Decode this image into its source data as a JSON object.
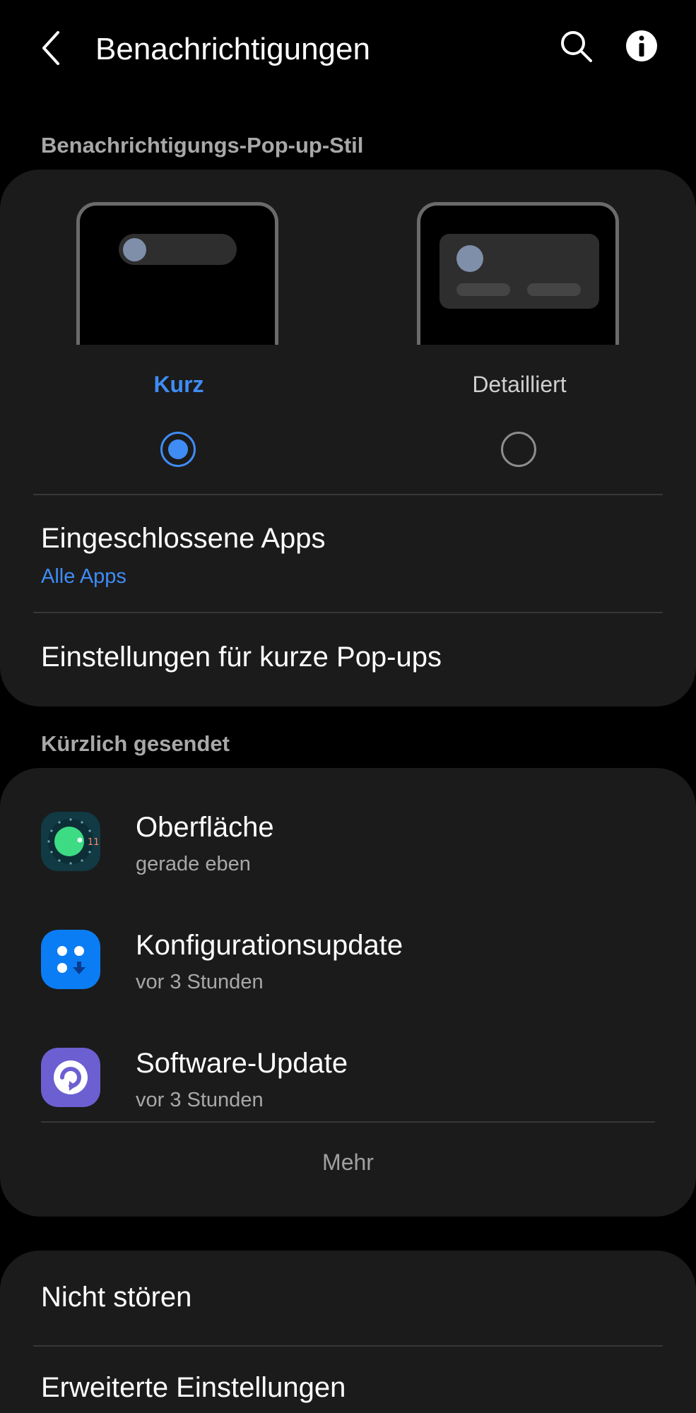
{
  "header": {
    "title": "Benachrichtigungen",
    "back_icon": "back-arrow-icon",
    "search_icon": "search-icon",
    "info_icon": "info-icon"
  },
  "popup_style": {
    "section_label": "Benachrichtigungs-Pop-up-Stil",
    "options": [
      {
        "label": "Kurz",
        "selected": true
      },
      {
        "label": "Detailliert",
        "selected": false
      }
    ],
    "included_apps": {
      "title": "Eingeschlossene Apps",
      "value": "Alle Apps"
    },
    "brief_settings": {
      "title": "Einstellungen für kurze Pop-ups"
    }
  },
  "recent": {
    "section_label": "Kürzlich gesendet",
    "items": [
      {
        "name": "Oberfläche",
        "time": "gerade eben",
        "icon": "android-11-icon"
      },
      {
        "name": "Konfigurationsupdate",
        "time": "vor 3 Stunden",
        "icon": "config-update-icon"
      },
      {
        "name": "Software-Update",
        "time": "vor 3 Stunden",
        "icon": "software-update-icon"
      }
    ],
    "more_label": "Mehr"
  },
  "more_settings": {
    "items": [
      {
        "title": "Nicht stören"
      },
      {
        "title": "Erweiterte Einstellungen"
      }
    ]
  },
  "colors": {
    "accent": "#3f8cf5",
    "background": "#000000",
    "card": "#1b1b1b"
  }
}
